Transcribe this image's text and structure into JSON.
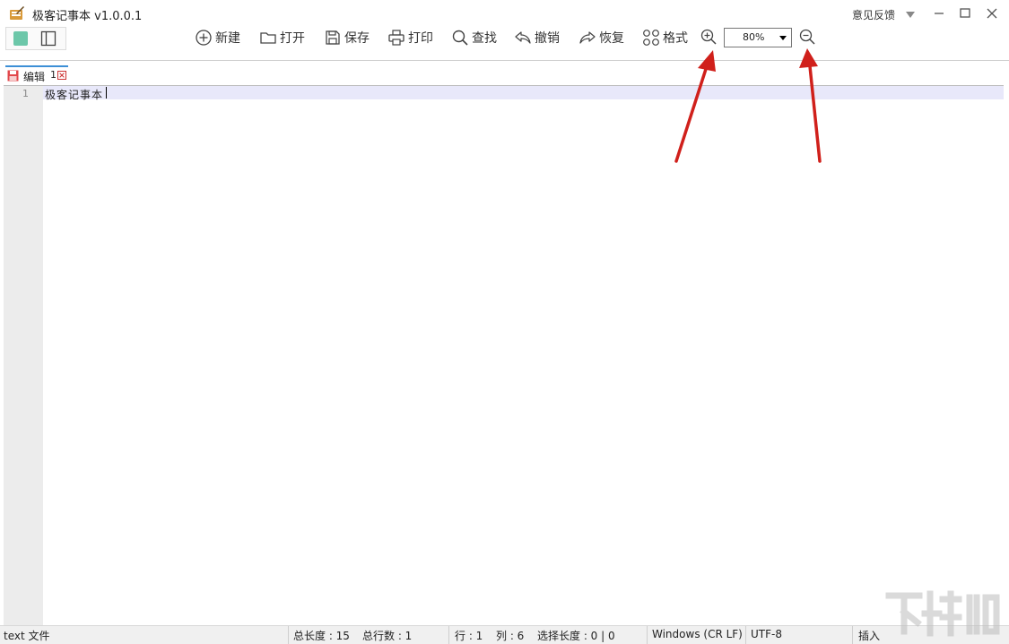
{
  "window": {
    "title": "极客记事本 v1.0.0.1",
    "feedback_label": "意见反馈"
  },
  "toolbar": {
    "new_label": "新建",
    "open_label": "打开",
    "save_label": "保存",
    "print_label": "打印",
    "find_label": "查找",
    "undo_label": "撤销",
    "redo_label": "恢复",
    "format_label": "格式",
    "zoom_value": "80%"
  },
  "tab": {
    "label": "编辑",
    "index": "1"
  },
  "editor": {
    "line_number": "1",
    "line_text": "极客记事本"
  },
  "statusbar": {
    "file_type": "text 文件",
    "total_length": "总长度 : 15",
    "total_lines": "总行数 : 1",
    "row": "行 : 1",
    "col": "列 : 6",
    "selection": "选择长度 : 0 | 0",
    "line_ending": "Windows (CR LF)",
    "encoding": "UTF-8",
    "mode": "插入"
  },
  "colors": {
    "accent": "#3c8fd6",
    "annotation_arrow": "#d0201b",
    "current_line": "#e8e8fa",
    "gutter": "#ececec"
  },
  "icons": [
    "app-icon",
    "new-icon",
    "open-icon",
    "save-icon",
    "print-icon",
    "search-icon",
    "undo-icon",
    "redo-icon",
    "format-icon",
    "zoom-in-icon",
    "zoom-out-icon",
    "minimize-icon",
    "maximize-icon",
    "close-icon"
  ]
}
